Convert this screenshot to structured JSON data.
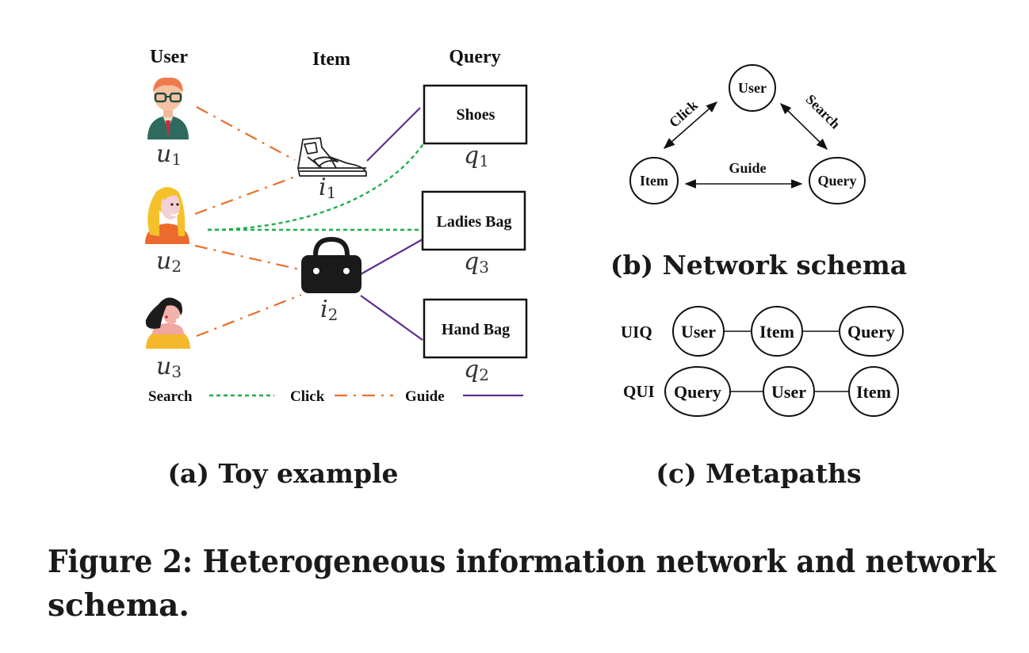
{
  "toy_example": {
    "headers": {
      "user": "User",
      "item": "Item",
      "query": "Query"
    },
    "users": [
      {
        "id": "u1",
        "symbol": "u",
        "sub": "1",
        "avatar": "man-with-glasses"
      },
      {
        "id": "u2",
        "symbol": "u",
        "sub": "2",
        "avatar": "blonde-woman"
      },
      {
        "id": "u3",
        "symbol": "u",
        "sub": "3",
        "avatar": "dark-haired-woman"
      }
    ],
    "items": [
      {
        "id": "i1",
        "symbol": "i",
        "sub": "1",
        "icon": "sneaker-icon"
      },
      {
        "id": "i2",
        "symbol": "i",
        "sub": "2",
        "icon": "handbag-icon"
      }
    ],
    "queries": [
      {
        "id": "q1",
        "label": "Shoes",
        "symbol": "q",
        "sub": "1"
      },
      {
        "id": "q3",
        "label": "Ladies Bag",
        "symbol": "q",
        "sub": "3"
      },
      {
        "id": "q2",
        "label": "Hand Bag",
        "symbol": "q",
        "sub": "2"
      }
    ],
    "edges": [
      {
        "type": "click",
        "from": "u1",
        "to": "i1"
      },
      {
        "type": "click",
        "from": "u2",
        "to": "i1"
      },
      {
        "type": "click",
        "from": "u2",
        "to": "i2"
      },
      {
        "type": "click",
        "from": "u3",
        "to": "i2"
      },
      {
        "type": "search",
        "from": "u2",
        "to": "q1"
      },
      {
        "type": "search",
        "from": "u2",
        "to": "q3"
      },
      {
        "type": "guide",
        "from": "i1",
        "to": "q1"
      },
      {
        "type": "guide",
        "from": "i2",
        "to": "q3"
      },
      {
        "type": "guide",
        "from": "i2",
        "to": "q2"
      }
    ],
    "legend": [
      {
        "label": "Search",
        "style": "dotted",
        "color": "#1fae4b"
      },
      {
        "label": "Click",
        "style": "dash-dot",
        "color": "#e8702a"
      },
      {
        "label": "Guide",
        "style": "solid",
        "color": "#5b2d91"
      }
    ],
    "caption": "(a) Toy example"
  },
  "network_schema": {
    "nodes": {
      "user": "User",
      "item": "Item",
      "query": "Query"
    },
    "relations": {
      "click": "Click",
      "search": "Search",
      "guide": "Guide"
    },
    "caption": "(b) Network schema"
  },
  "metapaths": {
    "paths": [
      {
        "name": "UIQ",
        "nodes": [
          "User",
          "Item",
          "Query"
        ]
      },
      {
        "name": "QUI",
        "nodes": [
          "Query",
          "User",
          "Item"
        ]
      }
    ],
    "caption": "(c) Metapaths"
  },
  "figure_caption": {
    "line1": "Figure 2: Heterogeneous information network and network",
    "line2": "schema."
  }
}
